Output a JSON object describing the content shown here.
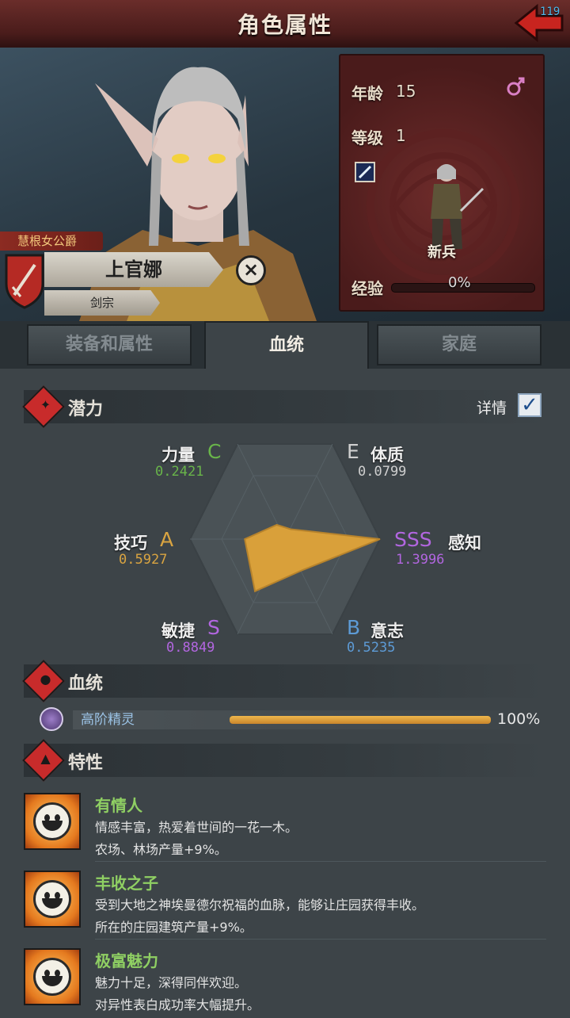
{
  "screen": {
    "title": "角色属性",
    "back_count": "119"
  },
  "character": {
    "noble_title": "慧根女公爵",
    "name": "上官娜",
    "class": "剑宗",
    "age_label": "年龄",
    "age": "15",
    "level_label": "等级",
    "level": "1",
    "unit_name": "新兵",
    "exp_label": "经验",
    "exp_percent": "0%",
    "exp_fraction": 0.0,
    "gender_icon": "female-icon"
  },
  "tabs": [
    {
      "label": "装备和属性",
      "active": false
    },
    {
      "label": "血统",
      "active": true
    },
    {
      "label": "家庭",
      "active": false
    }
  ],
  "potential": {
    "title": "潜力",
    "detail_label": "详情",
    "detail_checked": true,
    "stats": [
      {
        "name": "力量",
        "grade": "C",
        "value": "0.2421",
        "color": "#69b54a"
      },
      {
        "name": "体质",
        "grade": "E",
        "value": "0.0799",
        "color": "#cfcfcf"
      },
      {
        "name": "感知",
        "grade": "SSS",
        "value": "1.3996",
        "color": "#b266e0"
      },
      {
        "name": "意志",
        "grade": "B",
        "value": "0.5235",
        "color": "#5d9bd6"
      },
      {
        "name": "敏捷",
        "grade": "S",
        "value": "0.8849",
        "color": "#b266e0"
      },
      {
        "name": "技巧",
        "grade": "A",
        "value": "0.5927",
        "color": "#d9a441"
      }
    ],
    "radar_fill": "#d9a03a"
  },
  "lineage": {
    "title": "血统",
    "race": "高阶精灵",
    "percent": "100%",
    "fraction": 1.0
  },
  "traits": {
    "title": "特性",
    "items": [
      {
        "name": "有情人",
        "line1": "情感丰富，热爱着世间的一花一木。",
        "line2": "农场、林场产量+9%。"
      },
      {
        "name": "丰收之子",
        "line1": "受到大地之神埃曼德尔祝福的血脉，能够让庄园获得丰收。",
        "line2": "所在的庄园建筑产量+9%。"
      },
      {
        "name": "极富魅力",
        "line1": "魅力十足，深得同伴欢迎。",
        "line2": "对异性表白成功率大幅提升。"
      }
    ]
  }
}
